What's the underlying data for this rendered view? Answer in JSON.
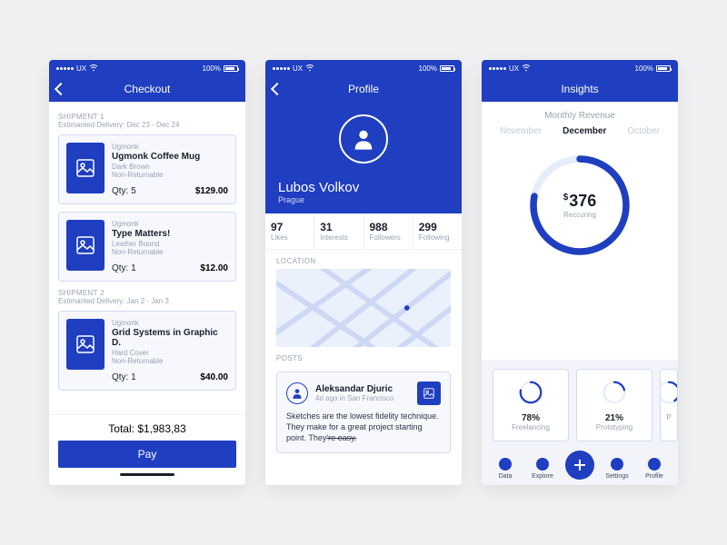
{
  "status": {
    "carrier": "UX",
    "wifi": "wifi-icon",
    "pct": "100%"
  },
  "checkout": {
    "title": "Checkout",
    "shipments": [
      {
        "head": "SHIPMENT 1",
        "sub": "Estimanted Delivery: Dec 23 - Dec 24",
        "items": [
          {
            "brand": "Ugmonk",
            "title": "Ugmonk Coffee Mug",
            "meta1": "Dark Brown",
            "meta2": "Non-Returnable",
            "qty": "Qty: 5",
            "price": "$129.00"
          },
          {
            "brand": "Ugmonk",
            "title": "Type Matters!",
            "meta1": "Leather Bound",
            "meta2": "Non-Returnable",
            "qty": "Qty: 1",
            "price": "$12.00"
          }
        ]
      },
      {
        "head": "SHIPMENT 2",
        "sub": "Estimanted Delivery: Jan 2 - Jan 3",
        "items": [
          {
            "brand": "Ugmonk",
            "title": "Grid Systems in Graphic D.",
            "meta1": "Hard Cover",
            "meta2": "Non-Returnable",
            "qty": "Qty: 1",
            "price": "$40.00"
          }
        ]
      }
    ],
    "total_label": "Total: $1,983,83",
    "pay_label": "Pay"
  },
  "profile": {
    "title": "Profile",
    "name": "Lubos Volkov",
    "city": "Prague",
    "stats": [
      {
        "v": "97",
        "l": "Likes"
      },
      {
        "v": "31",
        "l": "Interests"
      },
      {
        "v": "988",
        "l": "Followers"
      },
      {
        "v": "299",
        "l": "Following"
      }
    ],
    "location_label": "LOCATION",
    "posts_label": "POSTS",
    "post": {
      "author": "Aleksandar Djuric",
      "sub": "4d ago in San Francisco",
      "body": "Sketches are the lowest fidelity technique. They make for a great project starting point. They",
      "body_strike": "'re easy."
    }
  },
  "insights": {
    "title": "Insights",
    "section": "Monthly Revenue",
    "months": {
      "prev": "November",
      "curr": "December",
      "next": "October"
    },
    "gauge": {
      "currency": "$",
      "value": "376",
      "label": "Reccuring",
      "pct": 0.78
    },
    "minis": [
      {
        "pct_label": "78%",
        "label": "Freelancing",
        "pct": 0.78
      },
      {
        "pct_label": "21%",
        "label": "Prototyping",
        "pct": 0.21
      },
      {
        "pct_label": "",
        "label": "P",
        "pct": 0.4
      }
    ],
    "tabs": [
      {
        "label": "Data"
      },
      {
        "label": "Explore"
      },
      {
        "label": ""
      },
      {
        "label": "Settings"
      },
      {
        "label": "Profile"
      }
    ]
  },
  "colors": {
    "brand": "#1f3ec0",
    "muted": "#9aa3b0"
  }
}
